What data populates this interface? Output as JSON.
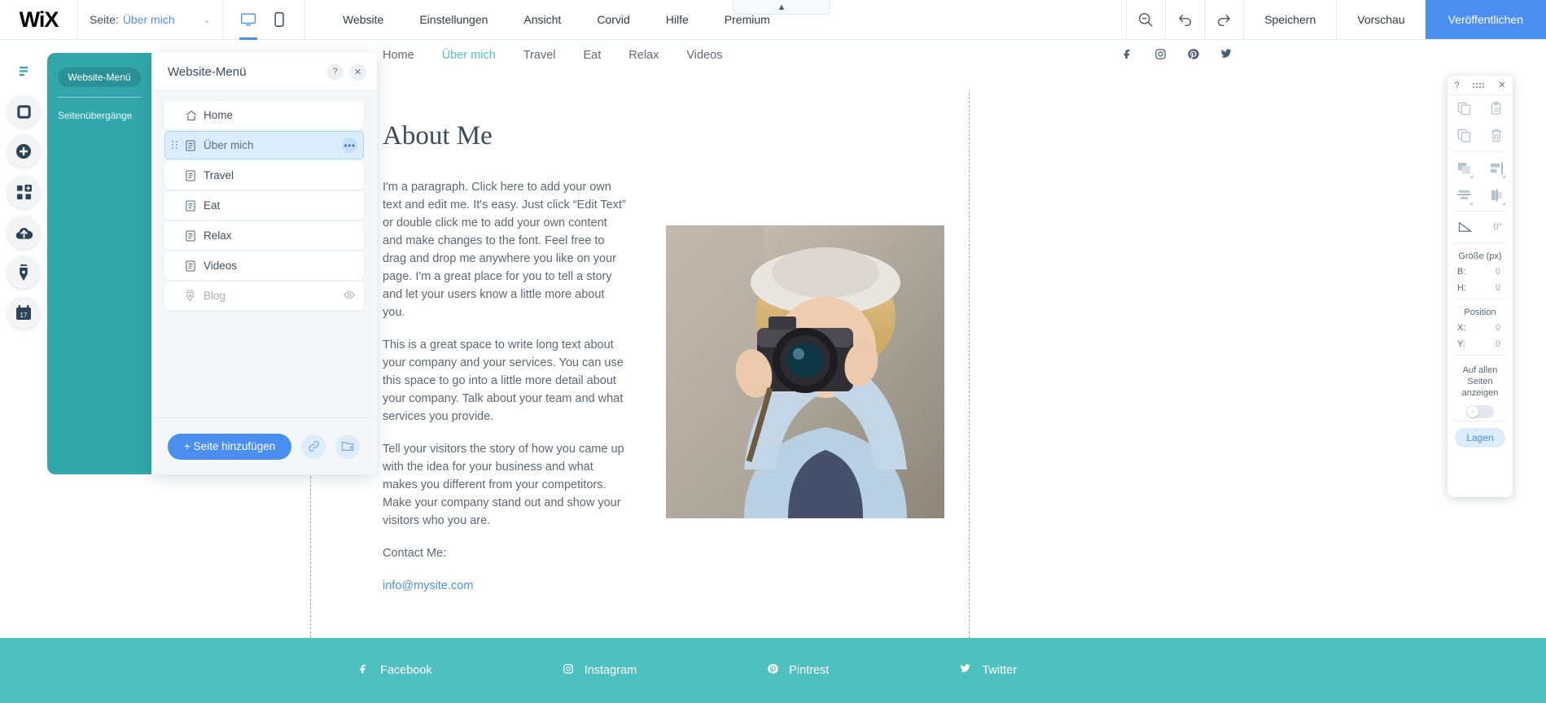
{
  "topbar": {
    "logo": "WiX",
    "page_label": "Seite:",
    "page_value": "Über mich",
    "chevron": "⌄",
    "devices": {
      "desktop": "desktop-icon",
      "mobile": "mobile-icon"
    },
    "menus": [
      "Website",
      "Einstellungen",
      "Ansicht",
      "Corvid",
      "Hilfe",
      "Premium"
    ],
    "zoom_out": "zoom-out-icon",
    "undo": "undo-icon",
    "redo": "redo-icon",
    "save": "Speichern",
    "preview": "Vorschau",
    "publish": "Veröffentlichen",
    "hidden_tab": "▲",
    "accent": "#4a8ff0"
  },
  "rail": {
    "items": [
      {
        "name": "menus-pages-icon",
        "glyph": "pages"
      },
      {
        "name": "background-icon",
        "glyph": "background"
      },
      {
        "name": "add-icon",
        "glyph": "add"
      },
      {
        "name": "apps-icon",
        "glyph": "apps"
      },
      {
        "name": "media-upload-icon",
        "glyph": "upload"
      },
      {
        "name": "blog-pen-icon",
        "glyph": "pen"
      },
      {
        "name": "bookings-calendar-icon",
        "glyph": "calendar"
      }
    ]
  },
  "teal_panel": {
    "pill": "Website-Menü",
    "sub": "Seitenübergänge",
    "color": "#31a7ab"
  },
  "menu_panel": {
    "title": "Website-Menü",
    "help_icon": "?",
    "close_icon": "✕",
    "pages": [
      {
        "label": "Home",
        "icon": "home-icon",
        "state": "normal"
      },
      {
        "label": "Über mich",
        "icon": "page-icon",
        "state": "selected",
        "more": "•••"
      },
      {
        "label": "Travel",
        "icon": "page-icon",
        "state": "normal"
      },
      {
        "label": "Eat",
        "icon": "page-icon",
        "state": "normal"
      },
      {
        "label": "Relax",
        "icon": "page-icon",
        "state": "normal"
      },
      {
        "label": "Videos",
        "icon": "page-icon",
        "state": "normal"
      },
      {
        "label": "Blog",
        "icon": "pen-nib-icon",
        "state": "disabled",
        "eye": "eye-hidden-icon"
      }
    ],
    "add_page": "+ Seite hinzufügen",
    "link_icon": "link-icon",
    "folder_icon": "folder-add-icon"
  },
  "right_toolbar": {
    "help": "?",
    "close": "✕",
    "actions": [
      {
        "name": "copy-icon"
      },
      {
        "name": "paste-icon"
      },
      {
        "name": "duplicate-icon"
      },
      {
        "name": "delete-icon"
      }
    ],
    "arrange": [
      {
        "name": "arrange-icon"
      },
      {
        "name": "align-icon"
      },
      {
        "name": "distribute-vertical-icon"
      },
      {
        "name": "distribute-horizontal-icon"
      }
    ],
    "rotate_icon": "rotate-angle-icon",
    "rotate_value": "0°",
    "size_title": "Größe (px)",
    "size_fields": [
      {
        "key": "B:",
        "value": "0"
      },
      {
        "key": "H:",
        "value": "0"
      }
    ],
    "position_title": "Position",
    "position_fields": [
      {
        "key": "X:",
        "value": "0"
      },
      {
        "key": "Y:",
        "value": "0"
      }
    ],
    "all_pages_label": "Auf allen Seiten anzeigen",
    "toggle_state": "off",
    "layers": "Lagen"
  },
  "site": {
    "nav": [
      "Home",
      "Über mich",
      "Travel",
      "Eat",
      "Relax",
      "Videos"
    ],
    "nav_active": "Über mich",
    "social": [
      "facebook-icon",
      "instagram-icon",
      "pinterest-icon",
      "twitter-icon"
    ],
    "title": "About Me",
    "paragraphs": [
      "I'm a paragraph. Click here to add your own text and edit me. It's easy. Just click “Edit Text” or double click me to add your own content and make changes to the font. Feel free to drag and drop me anywhere you like on your page. I'm a great place for you to tell a story and let your users know a little more about you.",
      "This is a great space to write long text about your company and your services. You can use this space to go into a little more detail about your company. Talk about your team and what services you provide.",
      "Tell your visitors the story of how you came up with the idea for your business and what makes you different from your competitors. Make your company stand out and show your visitors who you are."
    ],
    "contact_label": "Contact Me:",
    "contact_link": "info@mysite.com",
    "footer_links": [
      {
        "label": "Facebook",
        "icon": "facebook-icon"
      },
      {
        "label": "Instagram",
        "icon": "instagram-icon"
      },
      {
        "label": "Pintrest",
        "icon": "pinterest-icon"
      },
      {
        "label": "Twitter",
        "icon": "twitter-icon"
      }
    ],
    "footer_color": "#4fc0c0"
  }
}
